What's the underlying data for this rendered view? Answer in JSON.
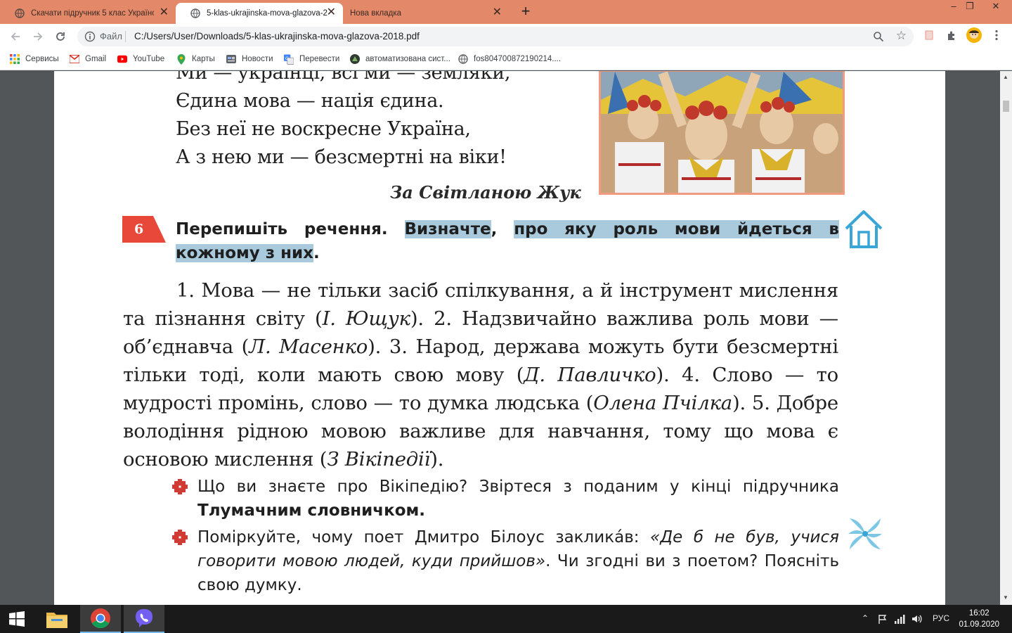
{
  "tabs": [
    {
      "title": "Скачати підручник 5 клас Українс",
      "close": "✕"
    },
    {
      "title": "5-klas-ukrajinska-mova-glazova-20",
      "close": "✕"
    },
    {
      "title": "Нова вкладка",
      "close": "✕"
    }
  ],
  "new_tab": "+",
  "window_controls": {
    "minimize": "–",
    "restore": "❐",
    "close": "✕"
  },
  "address_bar": {
    "file_label": "Файл",
    "url": "C:/Users/User/Downloads/5-klas-ukrajinska-mova-glazova-2018.pdf"
  },
  "bookmarks": [
    {
      "label": "Сервисы",
      "icon": "apps-grid-icon"
    },
    {
      "label": "Gmail",
      "icon": "gmail-icon"
    },
    {
      "label": "YouTube",
      "icon": "youtube-icon"
    },
    {
      "label": "Карты",
      "icon": "maps-pin-icon"
    },
    {
      "label": "Новости",
      "icon": "news-icon"
    },
    {
      "label": "Перевести",
      "icon": "translate-icon"
    },
    {
      "label": "автоматизована сист...",
      "icon": "site-icon"
    },
    {
      "label": "fos804700872190214....",
      "icon": "globe-icon"
    }
  ],
  "pdf": {
    "poem_lines": [
      "Ми — українці, всі ми — земляки,",
      "Єдина мова — нація єдина.",
      "Без неї не воскресне Україна,",
      "А з нею ми — безсмертні на віки!"
    ],
    "poem_author": "За Світланою Жук",
    "exercise_number": "6",
    "task": {
      "part1": "Перепишіть речення.",
      "hl1": "Визначте",
      "comma": ",",
      "hl2": "про яку роль мови йдеться в кожному з них",
      "dot": "."
    },
    "body": {
      "s1": "1. Мова — не тільки засіб спілкування, а й інструмент мислення та пізнання світу (",
      "a1": "І. Ющук",
      "s2": "). 2. Надзвичайно важлива роль мови — об’єднавча (",
      "a2": "Л. Масенко",
      "s3": "). 3. Народ, держава можуть бути безсмертні тільки тоді, коли мають свою мову (",
      "a3": "Д. Павличко",
      "s4": "). 4. Слово — то мудрості промінь, слово — то думка людська (",
      "a4": "Олена Пчілка",
      "s5": "). 5. Добре володіння рідною мовою важливе для навчання, тому що мова є основою мислення (",
      "a5": "З Вікіпедії",
      "s6": ")."
    },
    "q1": {
      "text": "Що ви знаєте про Вікіпедію? Звіртеся з поданим у кінці підручника ",
      "bold": "Тлумачним словничком",
      "end": "."
    },
    "q2": {
      "text": "Поміркуйте, чому поет Дмитро Білоус заклика́в: ",
      "quote": "«Де б не був, учися говорити мовою людей, куди прийшов»",
      "end": ". Чи згодні ви з поетом? Поясніть свою думку."
    }
  },
  "taskbar": {
    "language": "РУС",
    "time": "16:02",
    "date": "01.09.2020"
  },
  "colors": {
    "tabstrip": "#e3896a",
    "highlight": "#a9c9dd",
    "exercise_badge": "#e8483a",
    "icon_blue": "#3aa6d6"
  }
}
